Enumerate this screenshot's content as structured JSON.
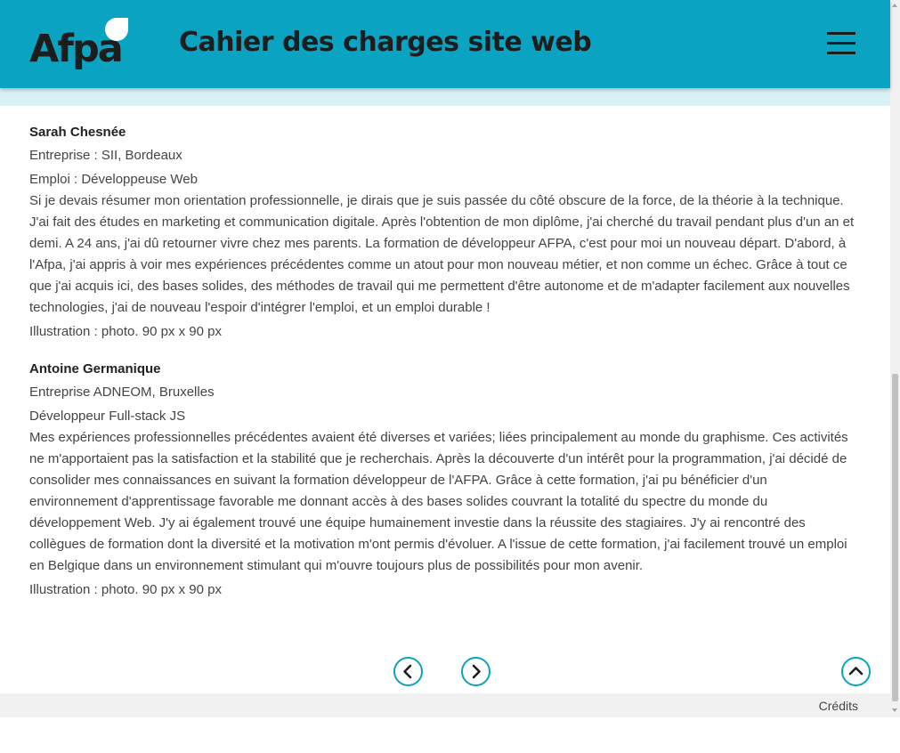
{
  "header": {
    "logo_text": "Afpa",
    "title": "Cahier des charges site web",
    "menu_icon": "hamburger-menu-icon",
    "background_color": "#0aa3c2"
  },
  "entries": [
    {
      "name": "Sarah Chesnée",
      "company": "Entreprise : SII, Bordeaux",
      "job": "Emploi : Développeuse Web",
      "testimonial": "Si je devais résumer mon orientation professionnelle, je dirais que je suis passée du côté obscure de la force, de la théorie à la technique. J'ai fait des études en marketing et communication digitale. Après l'obtention de mon diplôme, j'ai cherché du travail pendant plus d'un an et demi. A 24 ans, j'ai dû retourner vivre chez mes parents. La formation de développeur AFPA, c'est pour moi un nouveau départ. D'abord, à l'Afpa, j'ai appris à voir mes expériences précédentes comme un atout pour mon nouveau métier, et non comme un échec. Grâce à tout ce que j'ai acquis ici, des bases solides, des méthodes de travail qui me permettent d'être autonome et de m'adapter facilement aux nouvelles technologies, j'ai de nouveau l'espoir d'intégrer l'emploi, et un emploi durable !",
      "illustration": "Illustration : photo. 90 px x 90 px"
    },
    {
      "name": "Antoine Germanique",
      "company": "Entreprise ADNEOM, Bruxelles",
      "job": "Développeur Full-stack JS",
      "testimonial": "Mes expériences professionnelles précédentes avaient été diverses et variées; liées principalement au monde du graphisme. Ces activités ne m'apportaient pas la satisfaction et la stabilité que je recherchais. Après la découverte d'un intérêt pour la programmation, j'ai décidé de consolider mes connaissances en suivant la formation développeur de l'AFPA. Grâce à cette formation, j'ai pu bénéficier d'un environnement d'apprentissage favorable me donnant accès à des bases solides couvrant la totalité du spectre du monde du développement Web. J'y ai également trouvé une équipe humainement investie dans la réussite des stagiaires. J'y ai rencontré des collègues de formation dont la diversité et la motivation m'ont permis d'évoluer. A l'issue de cette formation, j'ai facilement trouvé un emploi en Belgique dans un environnement stimulant qui m'ouvre toujours plus de possibilités pour mon avenir.",
      "illustration": "Illustration : photo. 90 px x 90 px"
    }
  ],
  "navigation": {
    "prev_icon": "chevron-left-icon",
    "next_icon": "chevron-right-icon",
    "top_icon": "chevron-up-icon",
    "accent_color": "#0aa3c2"
  },
  "footer": {
    "credits_label": "Crédits"
  }
}
